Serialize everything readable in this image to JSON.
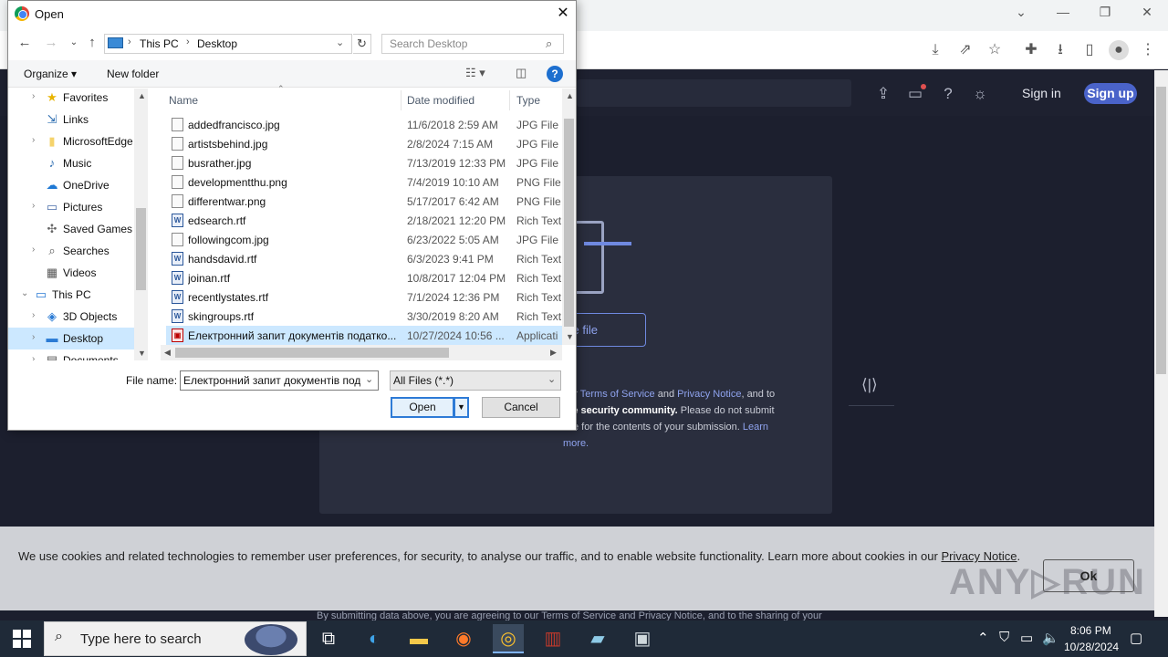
{
  "browser": {
    "window_controls": [
      "⌄",
      "—",
      "❐",
      "✕"
    ],
    "toolbar_icons": [
      "install-icon",
      "share-icon",
      "bookmark-star-icon",
      "extensions-icon",
      "downloads-icon",
      "side-panel-icon",
      "profile-icon"
    ]
  },
  "site": {
    "signin_label": "Sign in",
    "signup_label": "Sign up",
    "choose_file_label": "se file",
    "terms": {
      "line1_pre": "our ",
      "terms_link": "Terms of Service",
      "and": " and ",
      "privacy_link": "Privacy Notice",
      "line1_post": ", and to",
      "line2_bold": "the security community.",
      "line2_post": " Please do not submit",
      "line3": "ible for the contents of your submission. ",
      "learn_link": "Learn",
      "more_link": "more."
    },
    "cookie_text": "We use cookies and related technologies to remember user preferences, for security, to analyse our traffic, and to enable website functionality. Learn more about cookies in our ",
    "cookie_link": "Privacy Notice",
    "cookie_end": ".",
    "cookie_ok": "Ok",
    "bottom_text": "By submitting data above, you are agreeing to our Terms of Service and Privacy Notice, and to the sharing of your",
    "watermark": "ANY▷RUN"
  },
  "dialog": {
    "title": "Open",
    "close": "✕",
    "address": {
      "root": "This PC",
      "folder": "Desktop"
    },
    "search_placeholder": "Search Desktop",
    "toolbar": {
      "organize": "Organize ▾",
      "new_folder": "New folder",
      "help": "?"
    },
    "nav_items": [
      {
        "label": "Favorites",
        "icon": "★",
        "color": "#e8b400",
        "indent": 1,
        "arrow": "›"
      },
      {
        "label": "Links",
        "icon": "⇲",
        "color": "#2b6cb0",
        "indent": 1,
        "arrow": ""
      },
      {
        "label": "MicrosoftEdge",
        "icon": "▮",
        "color": "#f5d36b",
        "indent": 1,
        "arrow": "›"
      },
      {
        "label": "Music",
        "icon": "♪",
        "color": "#2b6cb0",
        "indent": 1,
        "arrow": ""
      },
      {
        "label": "OneDrive",
        "icon": "☁",
        "color": "#1e78d4",
        "indent": 1,
        "arrow": ""
      },
      {
        "label": "Pictures",
        "icon": "▭",
        "color": "#4a6ea9",
        "indent": 1,
        "arrow": "›"
      },
      {
        "label": "Saved Games",
        "icon": "✣",
        "color": "#666",
        "indent": 1,
        "arrow": ""
      },
      {
        "label": "Searches",
        "icon": "⌕",
        "color": "#555",
        "indent": 1,
        "arrow": "›"
      },
      {
        "label": "Videos",
        "icon": "▦",
        "color": "#555",
        "indent": 1,
        "arrow": ""
      },
      {
        "label": "This PC",
        "icon": "▭",
        "color": "#2b7bd4",
        "indent": 0,
        "arrow": "⌄"
      },
      {
        "label": "3D Objects",
        "icon": "◈",
        "color": "#2b7bd4",
        "indent": 1,
        "arrow": "›"
      },
      {
        "label": "Desktop",
        "icon": "▬",
        "color": "#2b7bd4",
        "indent": 1,
        "arrow": "›",
        "selected": true
      },
      {
        "label": "Documents",
        "icon": "▤",
        "color": "#555",
        "indent": 1,
        "arrow": "›"
      }
    ],
    "columns": {
      "name": "Name",
      "date": "Date modified",
      "type": "Type"
    },
    "files": [
      {
        "name": "addedfrancisco.jpg",
        "date": "11/6/2018 2:59 AM",
        "type": "JPG File",
        "kind": "img"
      },
      {
        "name": "artistsbehind.jpg",
        "date": "2/8/2024 7:15 AM",
        "type": "JPG File",
        "kind": "img"
      },
      {
        "name": "busrather.jpg",
        "date": "7/13/2019 12:33 PM",
        "type": "JPG File",
        "kind": "img"
      },
      {
        "name": "developmentthu.png",
        "date": "7/4/2019 10:10 AM",
        "type": "PNG File",
        "kind": "img"
      },
      {
        "name": "differentwar.png",
        "date": "5/17/2017 6:42 AM",
        "type": "PNG File",
        "kind": "img"
      },
      {
        "name": "edsearch.rtf",
        "date": "2/18/2021 12:20 PM",
        "type": "Rich Text",
        "kind": "rtf"
      },
      {
        "name": "followingcom.jpg",
        "date": "6/23/2022 5:05 AM",
        "type": "JPG File",
        "kind": "img"
      },
      {
        "name": "handsdavid.rtf",
        "date": "6/3/2023 9:41 PM",
        "type": "Rich Text",
        "kind": "rtf"
      },
      {
        "name": "joinan.rtf",
        "date": "10/8/2017 12:04 PM",
        "type": "Rich Text",
        "kind": "rtf"
      },
      {
        "name": "recentlystates.rtf",
        "date": "7/1/2024 12:36 PM",
        "type": "Rich Text",
        "kind": "rtf"
      },
      {
        "name": "skingroups.rtf",
        "date": "3/30/2019 8:20 AM",
        "type": "Rich Text",
        "kind": "rtf"
      },
      {
        "name": "Електронний запит документів податко...",
        "date": "10/27/2024 10:56 ...",
        "type": "Applicati",
        "kind": "app",
        "selected": true
      }
    ],
    "filename_label": "File name:",
    "filename_value": "Електронний запит документів под:",
    "filetype_value": "All Files (*.*)",
    "open_label": "Open",
    "cancel_label": "Cancel"
  },
  "taskbar": {
    "search_placeholder": "Type here to search",
    "apps": [
      "task-view-icon",
      "edge-icon",
      "file-explorer-icon",
      "firefox-icon",
      "chrome-icon",
      "winrar-icon",
      "notepad-icon",
      "control-panel-icon"
    ],
    "time": "8:06 PM",
    "date": "10/28/2024"
  }
}
